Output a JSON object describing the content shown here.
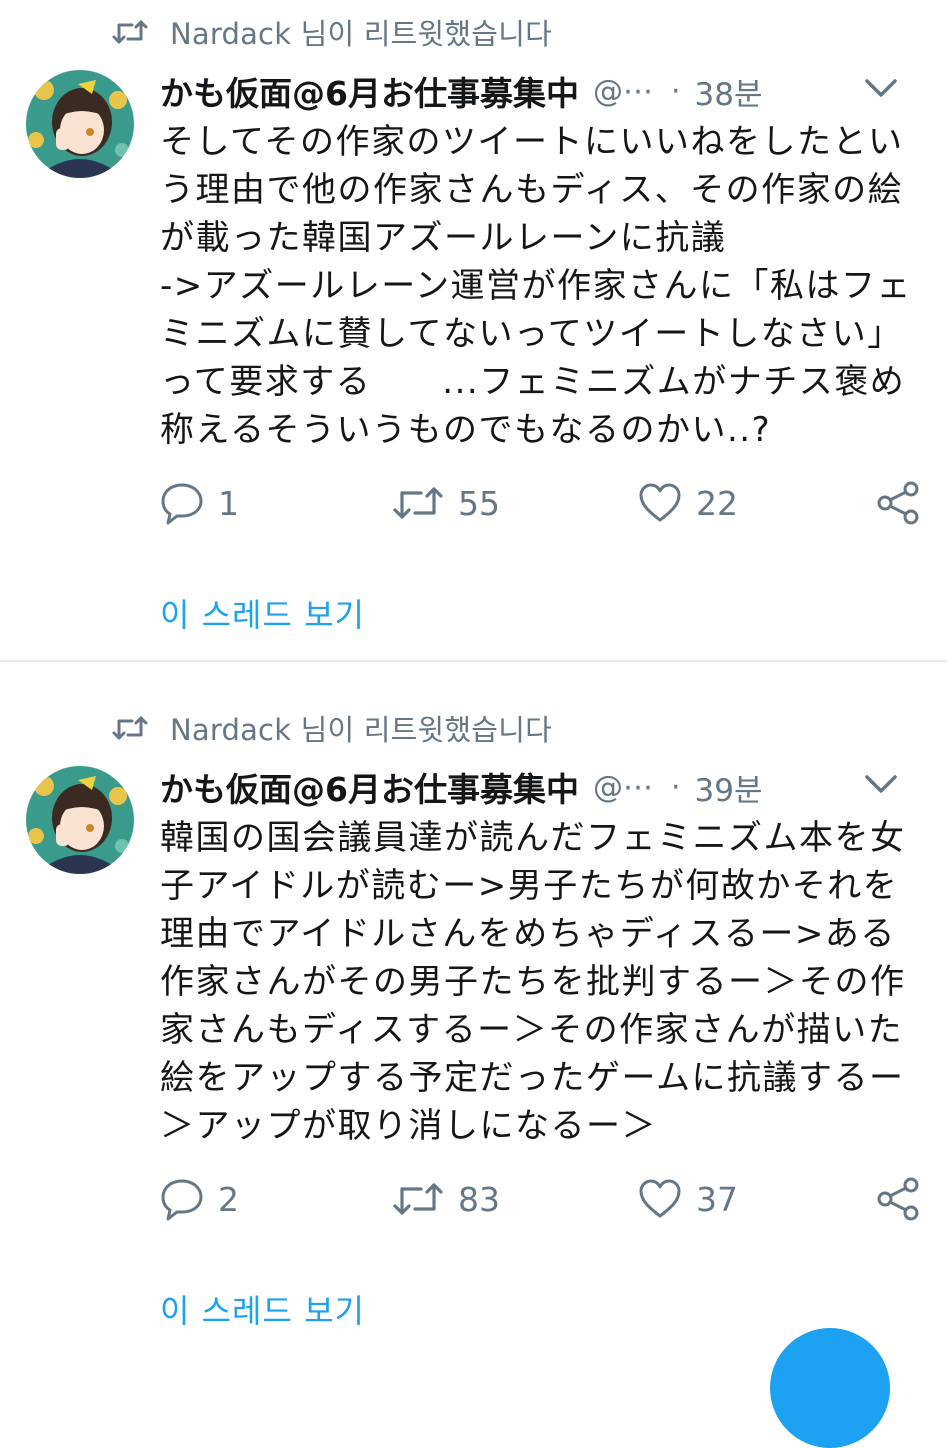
{
  "tweets": [
    {
      "retweeted_by": "Nardack 님이 리트윗했습니다",
      "author_name": "かも仮面@6月お仕事募集中",
      "handle": "@⋯",
      "separator": "·",
      "time": "38분",
      "text": "そしてその作家のツイートにいいねをしたという理由で他の作家さんもディス、その作家の絵が載った韓国アズールレーンに抗議\n->アズールレーン運営が作家さんに「私はフェミニズムに賛してないってツイートしなさい」って要求する　　...フェミニズムがナチス褒め称えるそういうものでもなるのかい..?",
      "reply_count": "1",
      "retweet_count": "55",
      "like_count": "22",
      "thread_link": "이 스레드 보기"
    },
    {
      "retweeted_by": "Nardack 님이 리트윗했습니다",
      "author_name": "かも仮面@6月お仕事募集中",
      "handle": "@⋯",
      "separator": "·",
      "time": "39분",
      "text": "韓国の国会議員達が読んだフェミニズム本を女子アイドルが読むー>男子たちが何故かそれを理由でアイドルさんをめちゃディスるー>ある作家さんがその男子たちを批判するー＞その作家さんもディスするー＞その作家さんが描いた絵をアップする予定だったゲームに抗議するー＞アップが取り消しになるー＞",
      "reply_count": "2",
      "retweet_count": "83",
      "like_count": "37",
      "thread_link": "이 스레드 보기"
    }
  ],
  "icons": {
    "retweet_indicator": "retweet-icon",
    "reply": "reply-icon",
    "retweet": "retweet-icon",
    "like": "heart-icon",
    "share": "share-icon",
    "menu": "chevron-down-icon"
  },
  "colors": {
    "accent": "#1da1f2",
    "secondary_text": "#657786",
    "primary_text": "#14171a",
    "divider": "#e6ecf0"
  }
}
